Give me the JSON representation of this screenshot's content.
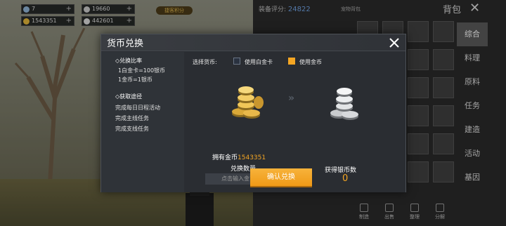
{
  "top_bar": {
    "resources": [
      {
        "value": "7",
        "color": "#8fb3d6"
      },
      {
        "value": "19660",
        "color": "#c9c9c9"
      },
      {
        "value": "1543351",
        "color": "#e0b43a"
      },
      {
        "value": "442601",
        "color": "#d8d8d8"
      }
    ],
    "vip_label": "捷客积分"
  },
  "inventory": {
    "score_label": "装备评分:",
    "score_value": "24822",
    "subtitle": "宠物背包",
    "title": "背包",
    "tabs": [
      {
        "label": "综合",
        "active": true
      },
      {
        "label": "料理",
        "active": false
      },
      {
        "label": "原料",
        "active": false
      },
      {
        "label": "任务",
        "active": false
      },
      {
        "label": "建造",
        "active": false
      },
      {
        "label": "活动",
        "active": false
      },
      {
        "label": "基因",
        "active": false
      }
    ],
    "bottom_actions": [
      "制造",
      "出售",
      "整理",
      "分解"
    ]
  },
  "dialog": {
    "title": "货币兑换",
    "rate_heading": "◇兑换比率",
    "rate_lines": [
      "1白金卡=100银币",
      "1金币=1银币"
    ],
    "source_heading": "◇获取途径",
    "source_lines": [
      "完成每日日程活动",
      "完成主线任务",
      "完成支线任务"
    ],
    "select_label": "选择货币:",
    "options": [
      {
        "label": "使用白金卡",
        "checked": false
      },
      {
        "label": "使用金币",
        "checked": true
      }
    ],
    "owned_label": "拥有金币",
    "owned_value": "1543351",
    "qty_label": "兑换数量",
    "input_placeholder": "点击输入金币数量",
    "receive_label": "获得银币数",
    "receive_value": "0",
    "confirm_label": "确认兑换",
    "arrow_glyph": "»",
    "colors": {
      "accent": "#f5a623",
      "panel": "#2b2e33"
    }
  }
}
